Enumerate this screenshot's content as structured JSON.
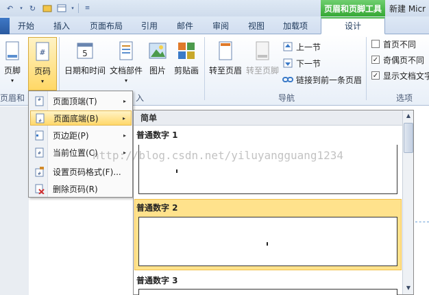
{
  "title_bar": {
    "contextual_tab_group": "页眉和页脚工具",
    "document_title": "新建 Micr"
  },
  "quick_access": {
    "icons": [
      "undo-icon",
      "dropdown-icon",
      "redo-icon",
      "open-icon",
      "view-icon",
      "dropdown-icon",
      "customize-icon"
    ]
  },
  "tabs": [
    {
      "label": "开始"
    },
    {
      "label": "插入"
    },
    {
      "label": "页面布局"
    },
    {
      "label": "引用"
    },
    {
      "label": "邮件"
    },
    {
      "label": "审阅"
    },
    {
      "label": "视图"
    },
    {
      "label": "加载项"
    },
    {
      "label": "设计",
      "active": true
    }
  ],
  "ribbon": {
    "footer_button": "页脚",
    "page_number_button": "页码",
    "datetime_button": "日期和时间",
    "docparts_button": "文档部件",
    "picture_button": "图片",
    "clipart_button": "剪贴画",
    "goto_header_button": "转至页眉",
    "goto_footer_button": "转至页脚",
    "prev_section": "上一节",
    "next_section": "下一节",
    "link_previous": "链接到前一条页眉",
    "groups": {
      "header_footer": "页眉和页脚",
      "insert_tail": "入",
      "navigation": "导航",
      "options": "选项"
    },
    "options": [
      {
        "label": "首页不同",
        "checked": false
      },
      {
        "label": "奇偶页不同",
        "checked": true
      },
      {
        "label": "显示文档文字",
        "checked": true
      }
    ]
  },
  "page_number_menu": {
    "items": [
      {
        "label": "页面顶端(T)",
        "submenu": true,
        "icon": "page-top-icon"
      },
      {
        "label": "页面底端(B)",
        "submenu": true,
        "icon": "page-bottom-icon",
        "highlighted": true
      },
      {
        "label": "页边距(P)",
        "submenu": true,
        "icon": "page-margin-icon"
      },
      {
        "label": "当前位置(C)",
        "submenu": true,
        "icon": "current-position-icon"
      },
      {
        "label": "设置页码格式(F)...",
        "submenu": false,
        "icon": "format-page-number-icon"
      },
      {
        "label": "删除页码(R)",
        "submenu": false,
        "icon": "delete-page-number-icon"
      }
    ]
  },
  "gallery": {
    "section_header": "简单",
    "items": [
      {
        "label": "普通数字 1",
        "number_position": "left"
      },
      {
        "label": "普通数字 2",
        "number_position": "center",
        "selected": true
      },
      {
        "label": "普通数字 3",
        "number_position": "right"
      }
    ]
  },
  "watermark": "http://blog.csdn.net/yiluyangguang1234",
  "colors": {
    "contextual_green": "#35a835",
    "highlight": "#ffd86a",
    "selected_item": "#ffe28c",
    "ribbon_text": "#1e395b"
  }
}
